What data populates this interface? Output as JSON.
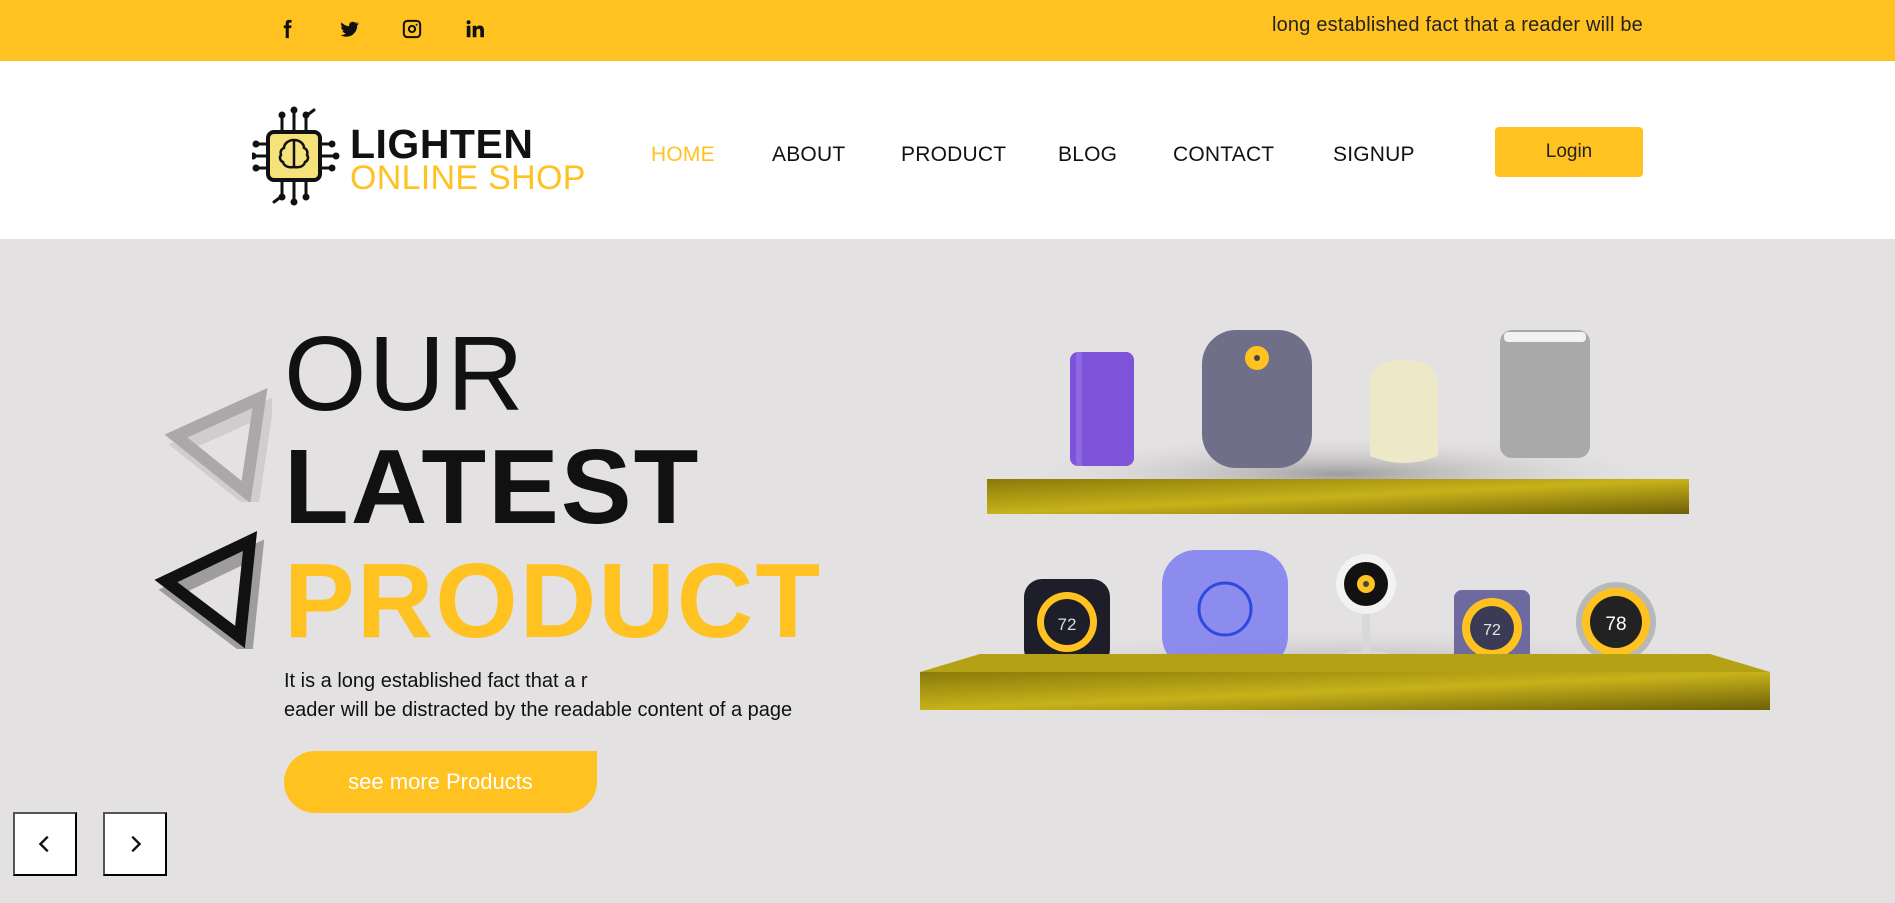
{
  "topbar": {
    "social": [
      {
        "name": "facebook",
        "glyph": "f"
      },
      {
        "name": "twitter",
        "glyph": "t"
      },
      {
        "name": "instagram",
        "glyph": "i"
      },
      {
        "name": "linkedin",
        "glyph": "in"
      }
    ],
    "tagline": "long established fact that a reader will be"
  },
  "logo": {
    "title": "LIGHTEN",
    "subtitle": "ONLINE SHOP"
  },
  "nav": {
    "home": "HOME",
    "about": "ABOUT",
    "product": "PRODUCT",
    "blog": "BLOG",
    "contact": "CONTACT",
    "signup": "SIGNUP",
    "login": "Login"
  },
  "hero": {
    "line1": "OUR",
    "line2": "LATEST",
    "line3": "PRODUCT",
    "desc_line1": "It is a long established fact that a r",
    "desc_line2": "eader will be distracted by the readable content of a page",
    "cta": "see more Products",
    "thermostat_a": "72",
    "thermostat_b": "72",
    "thermostat_c": "78"
  },
  "colors": {
    "accent": "#ffc221",
    "hero_bg": "#e3e1e2",
    "text": "#111111"
  }
}
